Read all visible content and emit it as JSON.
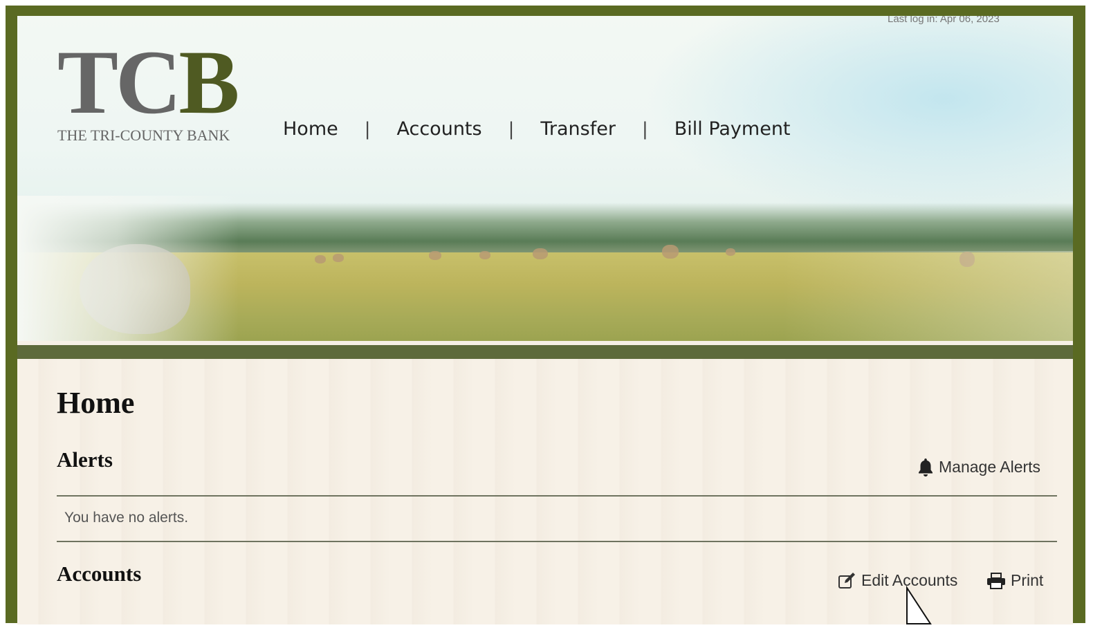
{
  "header": {
    "last_login": "Last log in: Apr 06, 2023",
    "logo_letters": "TCB",
    "logo_subtitle": "THE TRI-COUNTY BANK"
  },
  "nav": {
    "items": [
      "Home",
      "Accounts",
      "Transfer",
      "Bill Payment"
    ],
    "separator": "|"
  },
  "main": {
    "page_title": "Home",
    "alerts": {
      "title": "Alerts",
      "manage_label": "Manage Alerts",
      "empty_text": "You have no alerts."
    },
    "accounts": {
      "title": "Accounts",
      "edit_label": "Edit Accounts",
      "print_label": "Print"
    }
  },
  "colors": {
    "frame": "#5a6a22",
    "brand_green": "#4f5a22",
    "band": "#5d6a3b",
    "content_bg": "#f6f0e6"
  },
  "icons": [
    "bell-icon",
    "edit-icon",
    "printer-icon",
    "mouse-cursor-icon"
  ]
}
